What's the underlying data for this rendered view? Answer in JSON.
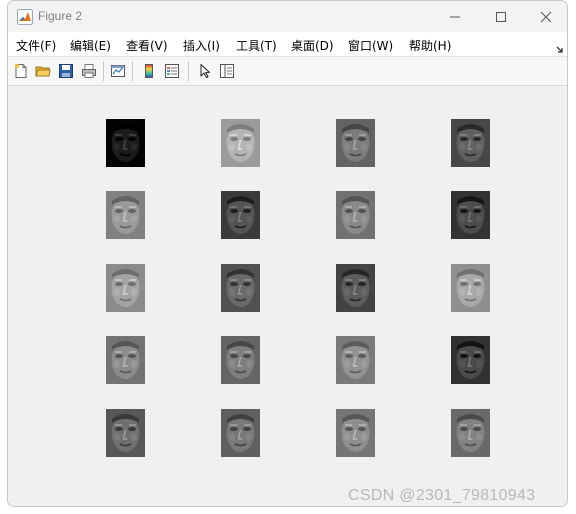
{
  "window": {
    "title": "Figure 2"
  },
  "menu": [
    "文件(F)",
    "编辑(E)",
    "查看(V)",
    "插入(I)",
    "工具(T)",
    "桌面(D)",
    "窗口(W)",
    "帮助(H)"
  ],
  "toolbar": {
    "icons": [
      "new-figure-icon",
      "open-file-icon",
      "save-icon",
      "print-icon",
      "link-plot-icon",
      "insert-colorbar-icon",
      "insert-legend-icon",
      "edit-plot-pointer-icon",
      "property-inspector-icon"
    ]
  },
  "figure": {
    "rows": 5,
    "cols": 4,
    "image_kind": "grayscale face subplot",
    "tones": [
      [
        "#1c1c1c",
        "#b4b4b4",
        "#7c7c7c",
        "#606060"
      ],
      [
        "#9a9a9a",
        "#545454",
        "#8a8a8a",
        "#4c4c4c"
      ],
      [
        "#a4a4a4",
        "#6a6a6a",
        "#5c5c5c",
        "#a8a8a8"
      ],
      [
        "#8c8c8c",
        "#7e7e7e",
        "#929292",
        "#4a4a4a"
      ],
      [
        "#707070",
        "#787878",
        "#8e8e8e",
        "#828282"
      ]
    ]
  },
  "watermark": "CSDN @2301_79810943"
}
